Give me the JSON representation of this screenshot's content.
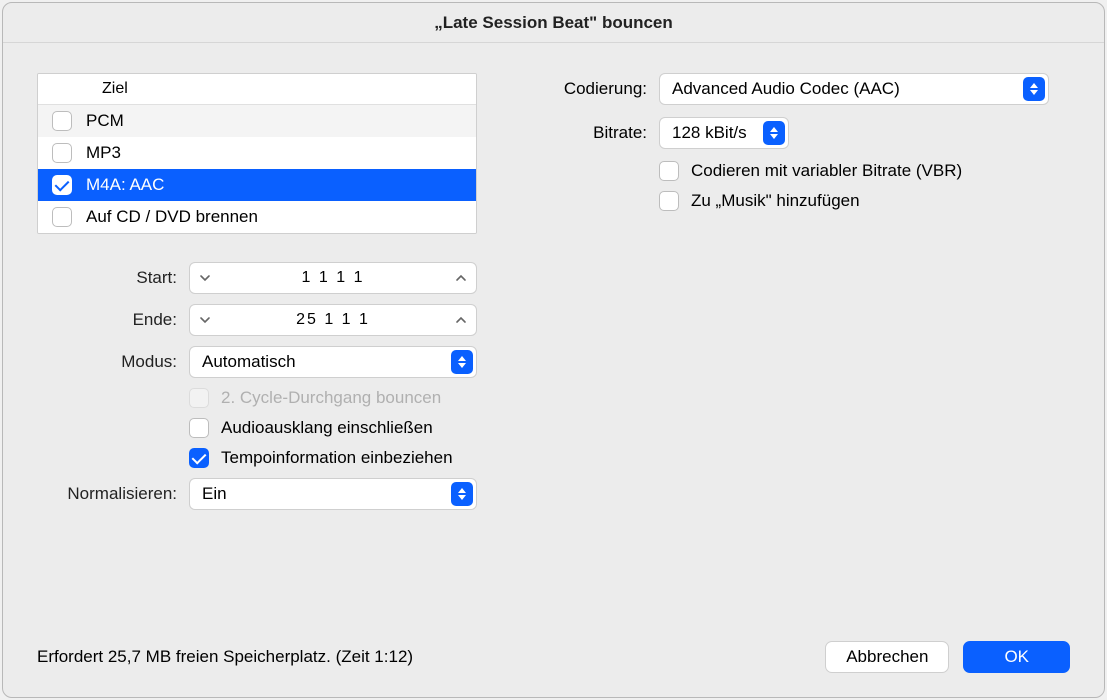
{
  "title": "„Late Session Beat\" bouncen",
  "destination": {
    "header": "Ziel",
    "items": [
      {
        "label": "PCM",
        "checked": false,
        "selected": false
      },
      {
        "label": "MP3",
        "checked": false,
        "selected": false
      },
      {
        "label": "M4A: AAC",
        "checked": true,
        "selected": true
      },
      {
        "label": "Auf CD / DVD brennen",
        "checked": false,
        "selected": false
      }
    ]
  },
  "range": {
    "start_label": "Start:",
    "start_value": "1  1  1      1",
    "end_label": "Ende:",
    "end_value": "25  1  1      1"
  },
  "mode": {
    "label": "Modus:",
    "value": "Automatisch",
    "second_cycle": {
      "label": "2. Cycle-Durchgang bouncen",
      "checked": false
    },
    "include_tail": {
      "label": "Audioausklang einschließen",
      "checked": false
    },
    "include_tempo": {
      "label": "Tempoinformation einbeziehen",
      "checked": true
    }
  },
  "normalize": {
    "label": "Normalisieren:",
    "value": "Ein"
  },
  "encoding": {
    "label": "Codierung:",
    "value": "Advanced Audio Codec (AAC)"
  },
  "bitrate": {
    "label": "Bitrate:",
    "value": "128 kBit/s",
    "vbr": {
      "label": "Codieren mit variabler Bitrate (VBR)",
      "checked": false
    },
    "add_music": {
      "label": "Zu „Musik\" hinzufügen",
      "checked": false
    }
  },
  "footer": {
    "status": "Erfordert 25,7 MB freien Speicherplatz. (Zeit 1:12)",
    "cancel": "Abbrechen",
    "ok": "OK"
  }
}
